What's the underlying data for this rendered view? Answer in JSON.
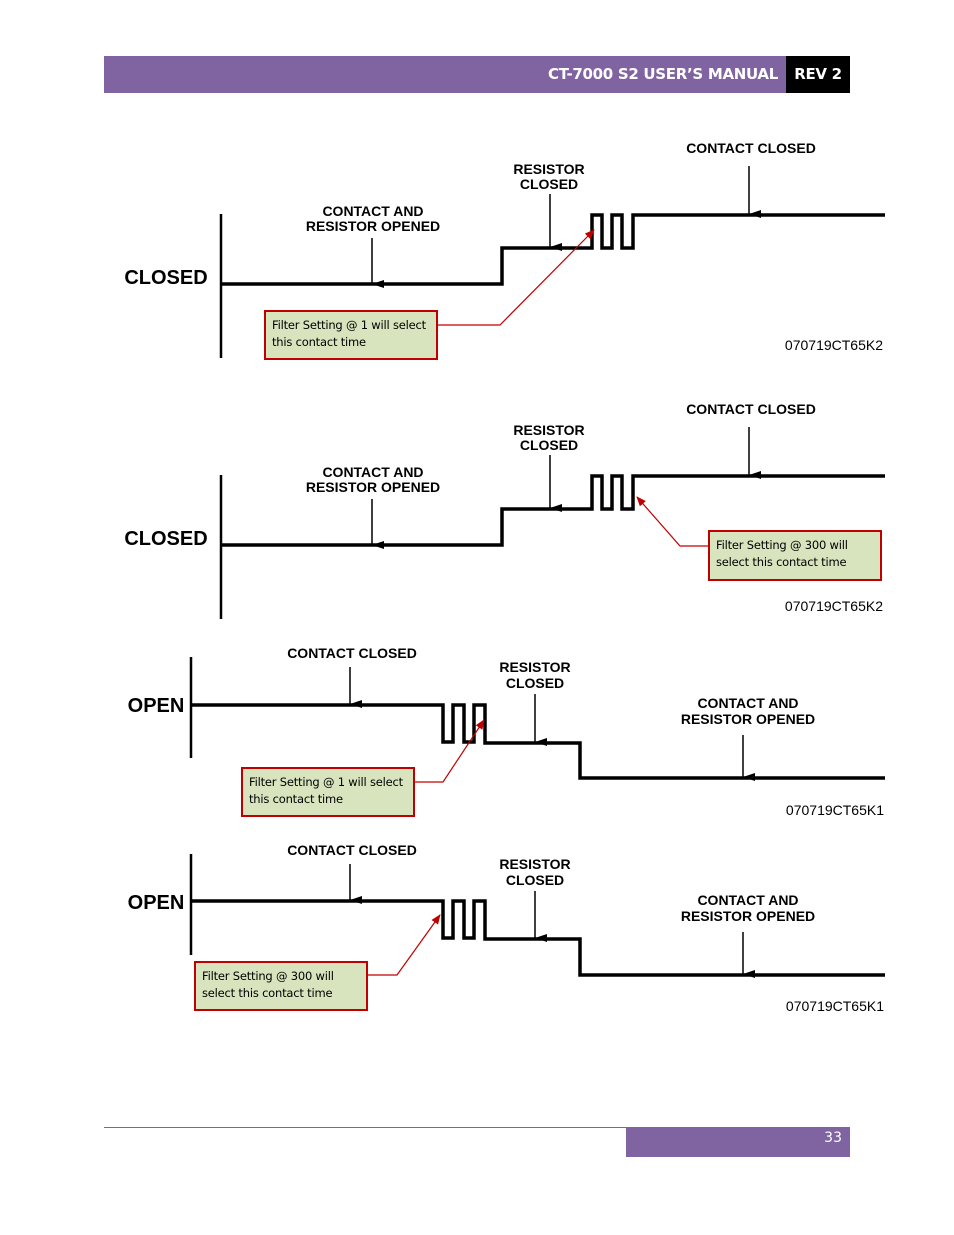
{
  "header": {
    "title": "CT-7000 S2 USER’S MANUAL",
    "revision": "REV 2"
  },
  "footer": {
    "page_number": "33"
  },
  "diagrams": [
    {
      "state_label": "CLOSED",
      "labels": {
        "contact_and_resistor_opened_1": "CONTACT AND",
        "contact_and_resistor_opened_2": "RESISTOR OPENED",
        "resistor_closed_1": "RESISTOR",
        "resistor_closed_2": "CLOSED",
        "contact_closed": "CONTACT CLOSED"
      },
      "callout": {
        "line1": "Filter Setting @ 1 will select",
        "line2": "this contact time"
      },
      "figure_id": "070719CT65K2"
    },
    {
      "state_label": "CLOSED",
      "labels": {
        "contact_and_resistor_opened_1": "CONTACT AND",
        "contact_and_resistor_opened_2": "RESISTOR OPENED",
        "resistor_closed_1": "RESISTOR",
        "resistor_closed_2": "CLOSED",
        "contact_closed": "CONTACT CLOSED"
      },
      "callout": {
        "line1": "Filter Setting @ 300  will",
        "line2": "select this contact time"
      },
      "figure_id": "070719CT65K2"
    },
    {
      "state_label": "OPEN",
      "labels": {
        "contact_closed": "CONTACT CLOSED",
        "resistor_closed_1": "RESISTOR",
        "resistor_closed_2": "CLOSED",
        "contact_and_resistor_opened_1": "CONTACT AND",
        "contact_and_resistor_opened_2": "RESISTOR OPENED"
      },
      "callout": {
        "line1": "Filter Setting @ 1 will select",
        "line2": "this contact time"
      },
      "figure_id": "070719CT65K1"
    },
    {
      "state_label": "OPEN",
      "labels": {
        "contact_closed": "CONTACT CLOSED",
        "resistor_closed_1": "RESISTOR",
        "resistor_closed_2": "CLOSED",
        "contact_and_resistor_opened_1": "CONTACT AND",
        "contact_and_resistor_opened_2": "RESISTOR OPENED"
      },
      "callout": {
        "line1": "Filter Setting @ 300 will",
        "line2": "select this contact time"
      },
      "figure_id": "070719CT65K1"
    }
  ],
  "colors": {
    "brand_purple": "#8064a2",
    "callout_fill": "#d7e4bd",
    "callout_border": "#c00000",
    "leader_line": "#c00000"
  }
}
